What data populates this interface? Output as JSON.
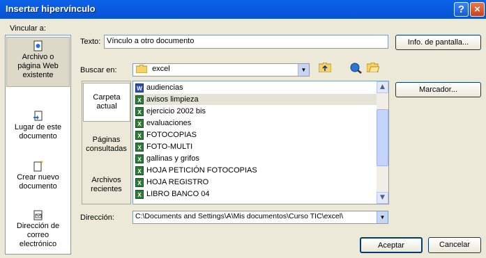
{
  "window": {
    "title": "Insertar hipervínculo",
    "help_glyph": "?",
    "close_glyph": "×"
  },
  "link_to": {
    "label": "Vincular a:",
    "items": [
      {
        "id": "existing",
        "line1": "Archivo o",
        "line2": "página Web",
        "line3": "existente",
        "icon": "file-web-icon",
        "selected": true
      },
      {
        "id": "place",
        "line1": "Lugar de este",
        "line2": "documento",
        "icon": "document-place-icon",
        "selected": false
      },
      {
        "id": "new",
        "line1": "Crear nuevo",
        "line2": "documento",
        "icon": "new-document-icon",
        "selected": false
      },
      {
        "id": "email",
        "line1": "Dirección de",
        "line2": "correo",
        "line3": "electrónico",
        "icon": "email-icon",
        "selected": false
      }
    ]
  },
  "text_field": {
    "label": "Texto:",
    "value": "Vínculo a otro documento"
  },
  "screentip_button": "Info. de pantalla...",
  "lookin": {
    "label": "Buscar en:",
    "value": "excel",
    "arrow": "▼"
  },
  "bookmark_button": "Marcador...",
  "nav": [
    {
      "line1": "Carpeta",
      "line2": "actual",
      "selected": true
    },
    {
      "line1": "Páginas",
      "line2": "consultadas",
      "selected": false
    },
    {
      "line1": "Archivos",
      "line2": "recientes",
      "selected": false
    }
  ],
  "files": [
    {
      "name": "audiencias",
      "type": "doc"
    },
    {
      "name": "avisos limpieza",
      "type": "xls",
      "selected": true
    },
    {
      "name": "ejercicio 2002 bis",
      "type": "xls"
    },
    {
      "name": "evaluaciones",
      "type": "xls"
    },
    {
      "name": "FOTOCOPIAS",
      "type": "xls"
    },
    {
      "name": "FOTO-MULTI",
      "type": "xls"
    },
    {
      "name": "gallinas y grifos",
      "type": "xls"
    },
    {
      "name": "HOJA PETICIÓN FOTOCOPIAS",
      "type": "xls"
    },
    {
      "name": "HOJA REGISTRO",
      "type": "xls"
    },
    {
      "name": "LIBRO BANCO 04",
      "type": "xls"
    }
  ],
  "address": {
    "label": "Dirección:",
    "value": "C:\\Documents and Settings\\A\\Mis documentos\\Curso TIC\\excel\\",
    "arrow": "▼"
  },
  "buttons": {
    "ok": "Aceptar",
    "cancel": "Cancelar"
  },
  "icons": {
    "up_folder": "up-folder-icon",
    "browse_web": "browse-web-icon",
    "browse_file": "browse-file-icon",
    "scroll_up": "▲",
    "scroll_down": "▼"
  },
  "colors": {
    "titlebar": "#0a5be0",
    "face": "#ece9d8",
    "excel_icon": "#2f7a3a",
    "word_icon": "#2b4fb5"
  }
}
